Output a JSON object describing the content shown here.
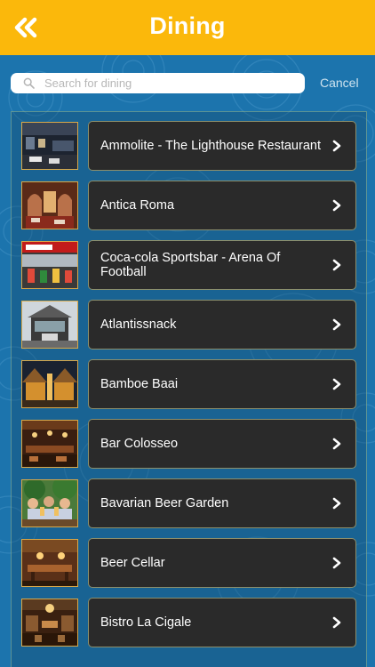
{
  "header": {
    "title": "Dining",
    "back_icon": "double-chevron-left-icon"
  },
  "search": {
    "placeholder": "Search for dining",
    "value": "",
    "icon": "search-icon",
    "cancel_label": "Cancel"
  },
  "colors": {
    "header_bg": "#fbb80b",
    "page_bg": "#1c74ad",
    "card_bg": "#2a2a2a"
  },
  "list": {
    "items": [
      {
        "label": "Ammolite - The Lighthouse Restaurant"
      },
      {
        "label": "Antica Roma"
      },
      {
        "label": "Coca-cola Sportsbar - Arena Of Football"
      },
      {
        "label": "Atlantissnack"
      },
      {
        "label": "Bamboe Baai"
      },
      {
        "label": "Bar Colosseo"
      },
      {
        "label": "Bavarian Beer Garden"
      },
      {
        "label": "Beer Cellar"
      },
      {
        "label": "Bistro La Cigale"
      }
    ]
  }
}
